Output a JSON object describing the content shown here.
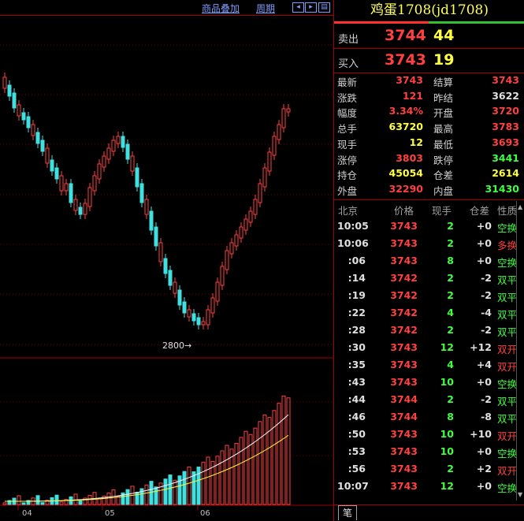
{
  "toolbar": {
    "overlay_label": "商品叠加",
    "period_label": "周期"
  },
  "instrument": {
    "title": "鸡蛋1708(jd1708)"
  },
  "quotes": {
    "sell": {
      "label": "卖出",
      "price": "3744",
      "volume": "44"
    },
    "buy": {
      "label": "买入",
      "price": "3743",
      "volume": "19"
    }
  },
  "stats": [
    {
      "l1": "最新",
      "v1": "3743",
      "c1": "#ff4040",
      "l2": "结算",
      "v2": "3743",
      "c2": "#ff4040"
    },
    {
      "l1": "涨跌",
      "v1": "121",
      "c1": "#ff4040",
      "l2": "昨结",
      "v2": "3622",
      "c2": "#e0e0e0"
    },
    {
      "l1": "幅度",
      "v1": "3.34%",
      "c1": "#ff4040",
      "l2": "开盘",
      "v2": "3720",
      "c2": "#ff4040"
    },
    {
      "l1": "总手",
      "v1": "63720",
      "c1": "#ffff40",
      "l2": "最高",
      "v2": "3783",
      "c2": "#ff4040"
    },
    {
      "l1": "现手",
      "v1": "12",
      "c1": "#ffff40",
      "l2": "最低",
      "v2": "3693",
      "c2": "#ff4040"
    },
    {
      "l1": "涨停",
      "v1": "3803",
      "c1": "#ff4040",
      "l2": "跌停",
      "v2": "3441",
      "c2": "#40ff40"
    },
    {
      "l1": "持仓",
      "v1": "45054",
      "c1": "#ffff40",
      "l2": "仓差",
      "v2": "2614",
      "c2": "#ffff40"
    },
    {
      "l1": "外盘",
      "v1": "32290",
      "c1": "#ff4040",
      "l2": "内盘",
      "v2": "31430",
      "c2": "#40ff40"
    }
  ],
  "ticks_header": {
    "time": "北京",
    "price": "价格",
    "qty": "现手",
    "diff": "仓差",
    "nature": "性质"
  },
  "ticks": [
    {
      "time": "10:05",
      "price": "3743",
      "qty": "2",
      "diff": "+0",
      "nature": "空换",
      "nc": "#40ff40"
    },
    {
      "time": "10:06",
      "price": "3743",
      "qty": "2",
      "diff": "+0",
      "nature": "多换",
      "nc": "#ff4040"
    },
    {
      "time": ":06",
      "price": "3743",
      "qty": "8",
      "diff": "+0",
      "nature": "空换",
      "nc": "#40ff40"
    },
    {
      "time": ":14",
      "price": "3742",
      "qty": "2",
      "diff": "-2",
      "nature": "双平",
      "nc": "#40ff40"
    },
    {
      "time": ":19",
      "price": "3742",
      "qty": "2",
      "diff": "-2",
      "nature": "双平",
      "nc": "#40ff40"
    },
    {
      "time": ":22",
      "price": "3742",
      "qty": "4",
      "diff": "-4",
      "nature": "双平",
      "nc": "#40ff40"
    },
    {
      "time": ":28",
      "price": "3742",
      "qty": "2",
      "diff": "-2",
      "nature": "双平",
      "nc": "#40ff40"
    },
    {
      "time": ":30",
      "price": "3743",
      "qty": "12",
      "diff": "+12",
      "nature": "双开",
      "nc": "#ff4040"
    },
    {
      "time": ":35",
      "price": "3743",
      "qty": "4",
      "diff": "+4",
      "nature": "双开",
      "nc": "#ff4040"
    },
    {
      "time": ":43",
      "price": "3743",
      "qty": "10",
      "diff": "+0",
      "nature": "空换",
      "nc": "#40ff40"
    },
    {
      "time": ":44",
      "price": "3744",
      "qty": "2",
      "diff": "-2",
      "nature": "双平",
      "nc": "#40ff40"
    },
    {
      "time": ":46",
      "price": "3744",
      "qty": "8",
      "diff": "-8",
      "nature": "双平",
      "nc": "#40ff40"
    },
    {
      "time": ":50",
      "price": "3743",
      "qty": "10",
      "diff": "+10",
      "nature": "双开",
      "nc": "#ff4040"
    },
    {
      "time": ":53",
      "price": "3743",
      "qty": "10",
      "diff": "+0",
      "nature": "空换",
      "nc": "#40ff40"
    },
    {
      "time": ":56",
      "price": "3743",
      "qty": "2",
      "diff": "+2",
      "nature": "双开",
      "nc": "#ff4040"
    },
    {
      "time": "10:07",
      "price": "3743",
      "qty": "12",
      "diff": "+0",
      "nature": "空换",
      "nc": "#40ff40"
    }
  ],
  "bottom_tab": "笔",
  "chart": {
    "low_marker": "2800→",
    "month_labels": [
      "04",
      "05",
      "06"
    ]
  }
}
